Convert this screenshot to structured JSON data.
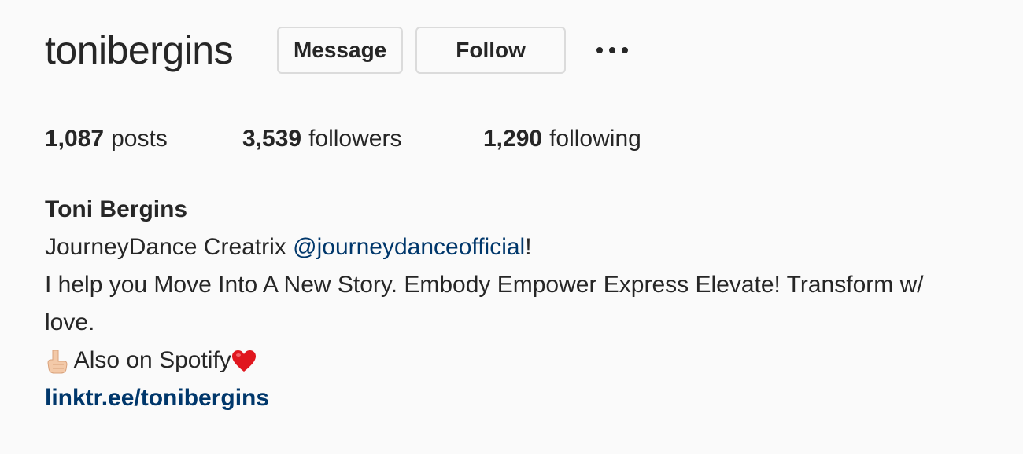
{
  "profile": {
    "username": "tonibergins",
    "message_label": "Message",
    "follow_label": "Follow",
    "more_icon": "more-options-icon"
  },
  "stats": {
    "posts_count": "1,087",
    "posts_label": "posts",
    "followers_count": "3,539",
    "followers_label": "followers",
    "following_count": "1,290",
    "following_label": "following"
  },
  "bio": {
    "full_name": "Toni Bergins",
    "line1_prefix": "JourneyDance Creatrix ",
    "line1_mention": "@journeydanceofficial",
    "line1_suffix": "!",
    "line2": "I help you Move Into A New Story. Embody Empower Express Elevate! Transform w/",
    "line3": "love.",
    "line4_text": " Also on Spotify",
    "link": "linktr.ee/tonibergins",
    "icons": [
      "pointing-down-icon",
      "red-heart-icon"
    ]
  },
  "colors": {
    "background": "#fafafa",
    "text": "#262626",
    "link": "#00376b",
    "button_border": "#dbdbdb",
    "heart": "#e0161e",
    "hand": "#f3c9a8"
  }
}
